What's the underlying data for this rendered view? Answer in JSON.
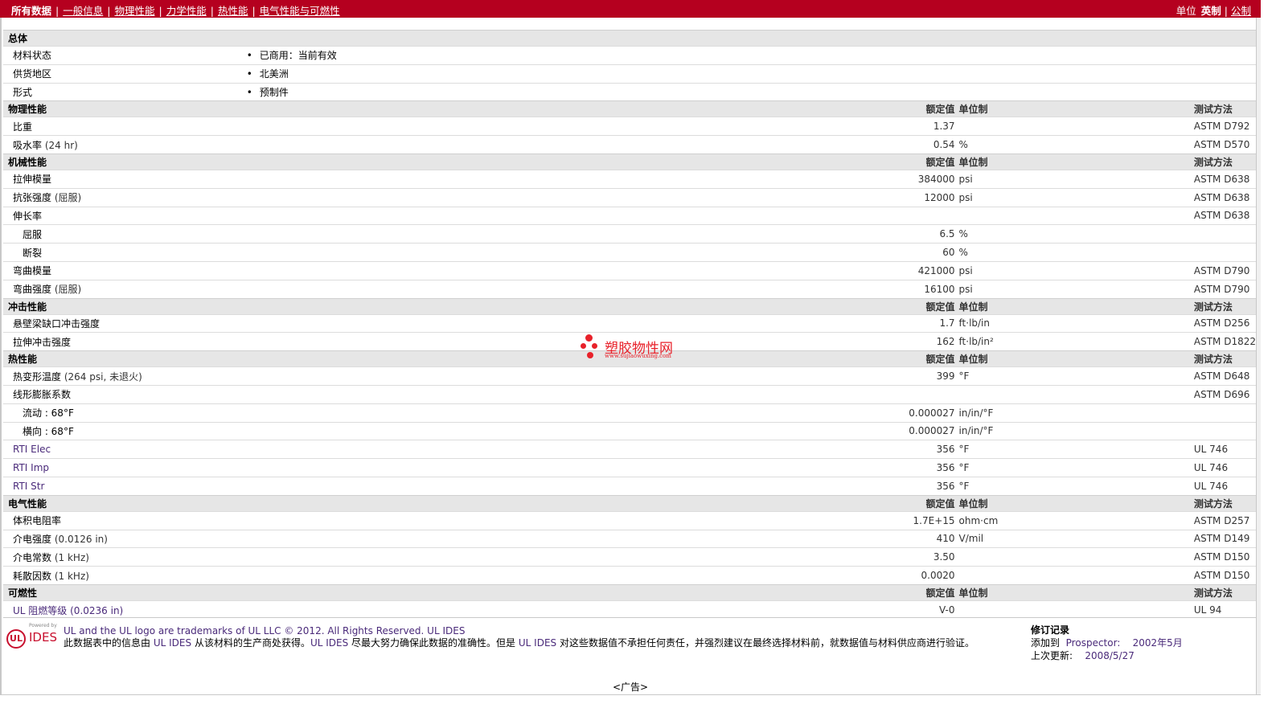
{
  "nav": {
    "items": [
      "所有数据",
      "一般信息",
      "物理性能",
      "力学性能",
      "热性能",
      "电气性能与可燃性"
    ],
    "units_label": "单位",
    "unit_active": "英制",
    "unit_other": "公制"
  },
  "columns": {
    "rated": "额定值",
    "unit": "单位制",
    "method": "测试方法"
  },
  "general": {
    "title": "总体",
    "rows": [
      {
        "label": "材料状态",
        "value": "已商用：当前有效"
      },
      {
        "label": "供货地区",
        "value": "北美洲"
      },
      {
        "label": "形式",
        "value": "预制件"
      }
    ]
  },
  "physical": {
    "title": "物理性能",
    "rows": [
      {
        "label": "比重",
        "cond": "",
        "value": "1.37",
        "unit": "",
        "method": "ASTM D792"
      },
      {
        "label": "吸水率",
        "cond": "(24 hr)",
        "value": "0.54",
        "unit": "%",
        "method": "ASTM D570"
      }
    ]
  },
  "mechanical": {
    "title": "机械性能",
    "rows": [
      {
        "label": "拉伸模量",
        "cond": "",
        "value": "384000",
        "unit": "psi",
        "method": "ASTM D638"
      },
      {
        "label": "抗张强度",
        "cond": "(屈服)",
        "value": "12000",
        "unit": "psi",
        "method": "ASTM D638"
      },
      {
        "label": "伸长率",
        "cond": "",
        "value": "",
        "unit": "",
        "method": "ASTM D638"
      },
      {
        "label": "屈服",
        "cond": "",
        "value": "6.5",
        "unit": "%",
        "method": ""
      },
      {
        "label": "断裂",
        "cond": "",
        "value": "60",
        "unit": "%",
        "method": ""
      },
      {
        "label": "弯曲模量",
        "cond": "",
        "value": "421000",
        "unit": "psi",
        "method": "ASTM D790"
      },
      {
        "label": "弯曲强度",
        "cond": "(屈服)",
        "value": "16100",
        "unit": "psi",
        "method": "ASTM D790"
      }
    ]
  },
  "impact": {
    "title": "冲击性能",
    "rows": [
      {
        "label": "悬壁梁缺口冲击强度",
        "value": "1.7",
        "unit": "ft·lb/in",
        "method": "ASTM D256"
      },
      {
        "label": "拉伸冲击强度",
        "value": "162",
        "unit": "ft·lb/in²",
        "method": "ASTM D1822"
      }
    ]
  },
  "thermal": {
    "title": "热性能",
    "rows": [
      {
        "label": "热变形温度",
        "cond": "(264 psi, 未退火)",
        "value": "399",
        "unit": "°F",
        "method": "ASTM D648"
      },
      {
        "label": "线形膨胀系数",
        "cond": "",
        "value": "",
        "unit": "",
        "method": "ASTM D696"
      },
      {
        "label": "流动 : 68°F",
        "cond": "",
        "value": "0.000027",
        "unit": "in/in/°F",
        "method": ""
      },
      {
        "label": "横向 : 68°F",
        "cond": "",
        "value": "0.000027",
        "unit": "in/in/°F",
        "method": ""
      },
      {
        "label": "RTI Elec",
        "cond": "",
        "value": "356",
        "unit": "°F",
        "method": "UL 746"
      },
      {
        "label": "RTI Imp",
        "cond": "",
        "value": "356",
        "unit": "°F",
        "method": "UL 746"
      },
      {
        "label": "RTI Str",
        "cond": "",
        "value": "356",
        "unit": "°F",
        "method": "UL 746"
      }
    ]
  },
  "electrical": {
    "title": "电气性能",
    "rows": [
      {
        "label": "体积电阻率",
        "cond": "",
        "value": "1.7E+15",
        "unit": "ohm·cm",
        "method": "ASTM D257"
      },
      {
        "label": "介电强度",
        "cond": "(0.0126 in)",
        "value": "410",
        "unit": "V/mil",
        "method": "ASTM D149"
      },
      {
        "label": "介电常数",
        "cond": "(1 kHz)",
        "value": "3.50",
        "unit": "",
        "method": "ASTM D150"
      },
      {
        "label": "耗散因数",
        "cond": "(1 kHz)",
        "value": "0.0020",
        "unit": "",
        "method": "ASTM D150"
      }
    ]
  },
  "flammability": {
    "title": "可燃性",
    "rows": [
      {
        "label": "UL 阻燃等级",
        "cond": "(0.0236 in)",
        "value": "V-0",
        "unit": "",
        "method": "UL 94"
      }
    ]
  },
  "watermark": {
    "title": "塑胶物性网",
    "url": "www.sujiaowuxing.com"
  },
  "footer": {
    "powered": "Powered by",
    "logo_ul": "UL",
    "logo_ides": "IDES",
    "trademark": "UL and the UL logo are trademarks of UL LLC © 2012. All Rights Reserved. UL IDES",
    "disclaimer_a": "此数据表中的信息由",
    "disclaimer_b": "UL IDES",
    "disclaimer_c": "从该材料的生产商处获得。",
    "disclaimer_d": "UL IDES",
    "disclaimer_e": "尽最大努力确保此数据的准确性。但是",
    "disclaimer_f": "UL IDES",
    "disclaimer_g": "对这些数据值不承担任何责任，并强烈建议在最终选择材料前，就数据值与材料供应商进行验证。",
    "rev_title": "修订记录",
    "added_label": "添加到",
    "added_where": "Prospector:",
    "added_date": "2002年5月",
    "updated_label": "上次更新:",
    "updated_date": "2008/5/27",
    "ad": "<广告>"
  }
}
